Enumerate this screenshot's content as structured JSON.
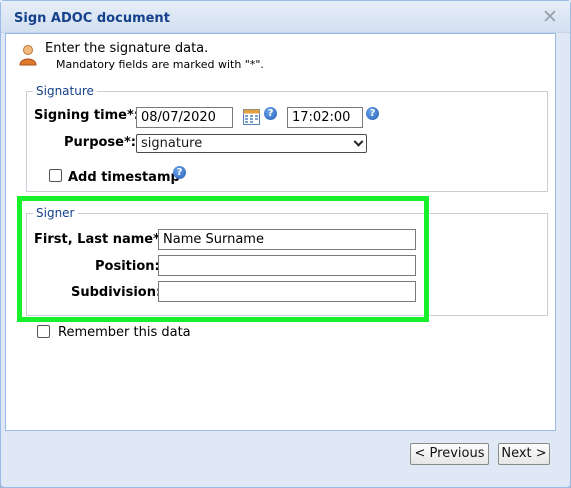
{
  "window": {
    "title": "Sign ADOC document",
    "close_glyph": "✕"
  },
  "info": {
    "line1": "Enter the signature data.",
    "line2": "Mandatory fields are marked with \"*\".",
    "icon": "user-icon"
  },
  "signature": {
    "legend": "Signature",
    "signing_time_label": "Signing time*:",
    "date_value": "08/07/2020",
    "time_value": "17:02:00",
    "purpose_label": "Purpose*:",
    "purpose_value": "signature",
    "add_timestamp_label": "Add timestamp",
    "add_timestamp_checked": false,
    "help_glyph": "?"
  },
  "signer": {
    "legend": "Signer",
    "name_label": "First, Last name*:",
    "name_value": "Name Surname",
    "position_label": "Position:",
    "position_value": "",
    "subdivision_label": "Subdivision:",
    "subdivision_value": ""
  },
  "remember": {
    "label": "Remember this data",
    "checked": false
  },
  "buttons": {
    "previous": "< Previous",
    "next": "Next >"
  },
  "colors": {
    "highlight": "#19f02c",
    "title": "#15428b",
    "dialog_bg": "#dfe8f4"
  }
}
